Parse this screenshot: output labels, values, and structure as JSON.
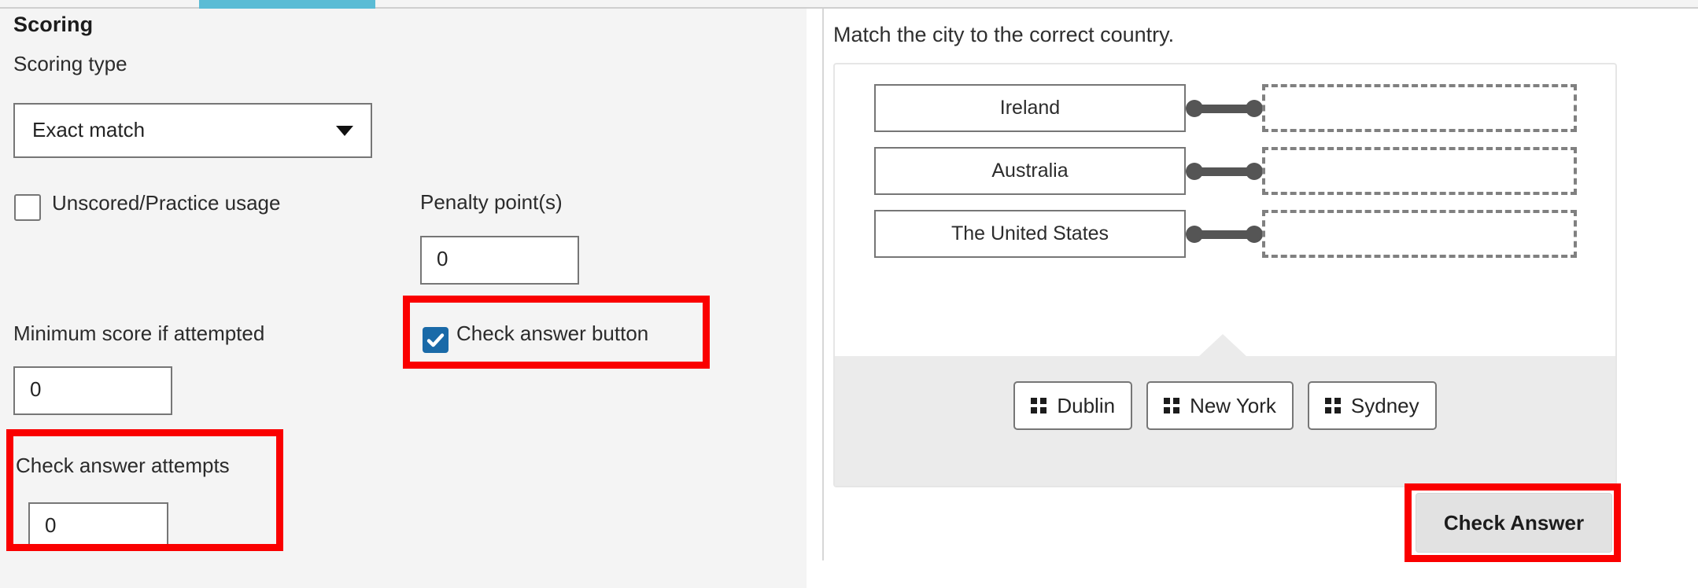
{
  "tabs": {
    "active_indicator_color": "#5bbcd5"
  },
  "scoring_panel": {
    "title": "Scoring",
    "scoring_type": {
      "label": "Scoring type",
      "selected": "Exact match",
      "caret_icon": "chevron-down-icon"
    },
    "unscored": {
      "label": "Unscored/Practice usage",
      "checked": false
    },
    "penalty": {
      "label": "Penalty point(s)",
      "value": "0"
    },
    "min_score": {
      "label": "Minimum score if attempted",
      "value": "0"
    },
    "check_answer_button_toggle": {
      "label": "Check answer button",
      "checked": true,
      "checkbox_color": "#1a6aa8",
      "check_icon": "checkmark-icon"
    },
    "check_answer_attempts": {
      "label": "Check answer attempts",
      "value": "0"
    }
  },
  "annotations": {
    "color": "#fa0000",
    "boxes": [
      "check-answer-button-toggle",
      "check-answer-attempts",
      "check-answer-button"
    ]
  },
  "preview": {
    "prompt": "Match the city to the correct country.",
    "pairs": [
      {
        "left": "Ireland",
        "drop_placeholder": ""
      },
      {
        "left": "Australia",
        "drop_placeholder": ""
      },
      {
        "left": "The United States",
        "drop_placeholder": ""
      }
    ],
    "tray_tokens": [
      {
        "label": "Dublin",
        "grip_icon": "drag-handle-icon"
      },
      {
        "label": "New York",
        "grip_icon": "drag-handle-icon"
      },
      {
        "label": "Sydney",
        "grip_icon": "drag-handle-icon"
      }
    ],
    "check_answer_button": {
      "label": "Check Answer"
    }
  }
}
